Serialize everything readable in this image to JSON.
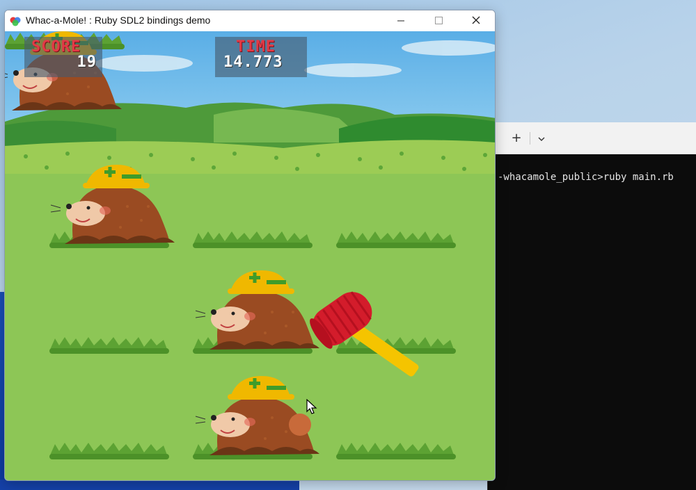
{
  "window": {
    "title": "Whac-a-Mole! : Ruby SDL2 bindings demo"
  },
  "hud": {
    "score_label": "SCORE",
    "score_value": "19",
    "time_label": "TIME",
    "time_value": "14.773"
  },
  "terminal": {
    "new_tab_label": "+",
    "dropdown_label": "⌄",
    "prompt_line": "-whacamole_public>ruby main.rb"
  },
  "game": {
    "grid_rows": 3,
    "grid_cols": 3,
    "moles_up": [
      {
        "row": 0,
        "col": 0
      },
      {
        "row": 1,
        "col": 1
      },
      {
        "row": 2,
        "col": 1
      }
    ],
    "colors": {
      "sky": "#6bb3e3",
      "field": "#8dc656",
      "mole": "#9a4b22",
      "helmet": "#f0b800",
      "hammer_head": "#d31c2b",
      "hammer_handle": "#f5c400",
      "score_label": "#e23a46"
    },
    "icons": {
      "hammer": "hammer-icon",
      "cursor": "arrow-cursor-icon"
    }
  }
}
